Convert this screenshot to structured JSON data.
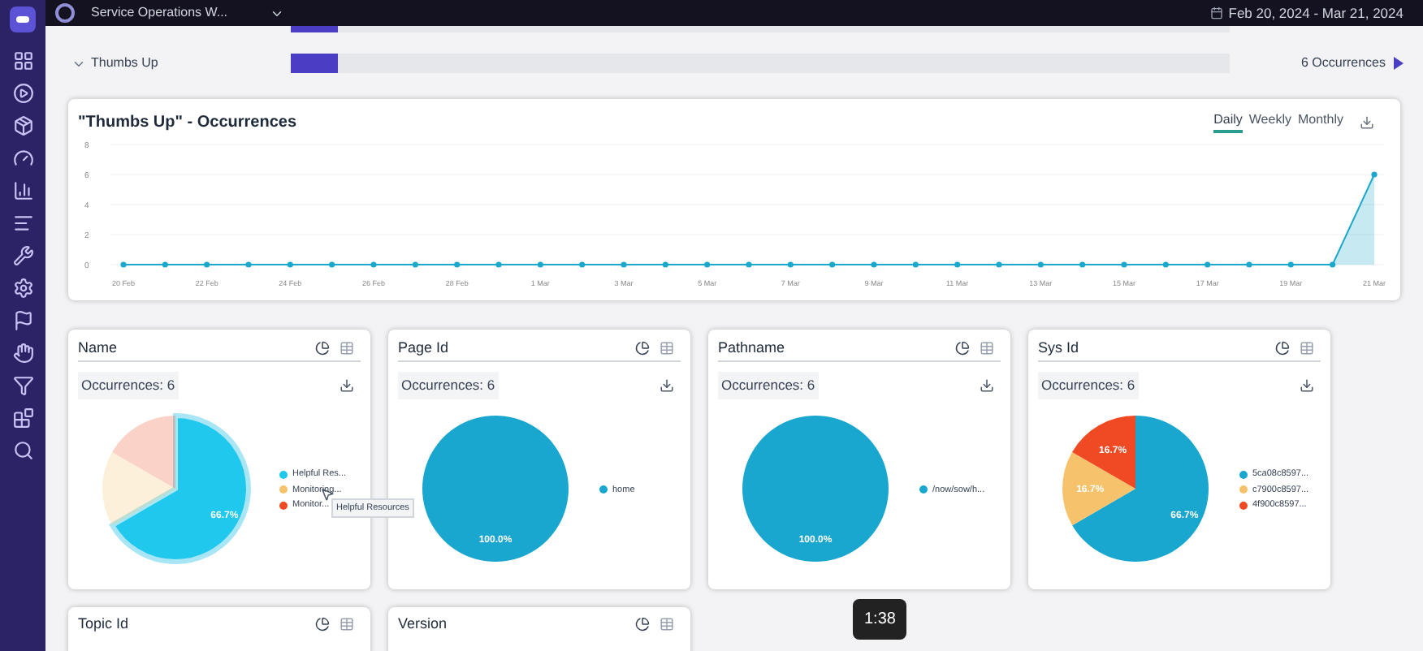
{
  "top_bar": {
    "workspace": "Service Operations W...",
    "date_range": "Feb 20, 2024 - Mar 21, 2024"
  },
  "bars": [
    {
      "level": 0.05
    },
    {
      "label": "Thumbs Up",
      "level": 0.05,
      "expanded": true,
      "count": "6 Occurrences"
    }
  ],
  "trend_card": {
    "title": "\"Thumbs Up\" - Occurrences",
    "tabs": [
      {
        "label": "Daily",
        "selected": true
      },
      {
        "label": "Weekly",
        "selected": false
      },
      {
        "label": "Monthly",
        "selected": false
      }
    ],
    "chart_data": {
      "type": "area",
      "categories": [
        "20 Feb",
        null,
        "22 Feb",
        null,
        "24 Feb",
        null,
        "26 Feb",
        null,
        "28 Feb",
        null,
        "1 Mar",
        null,
        "3 Mar",
        null,
        "5 Mar",
        null,
        "7 Mar",
        null,
        "9 Mar",
        null,
        "11 Mar",
        null,
        "13 Mar",
        null,
        "15 Mar",
        null,
        "17 Mar",
        null,
        "19 Mar",
        null,
        "21 Mar"
      ],
      "series": [
        {
          "color": "#1ba8cc",
          "values": [
            0,
            0,
            0,
            0,
            0,
            0,
            0,
            0,
            0,
            0,
            0,
            0,
            0,
            0,
            0,
            0,
            0,
            0,
            0,
            0,
            0,
            0,
            0,
            0,
            0,
            0,
            0,
            0,
            0,
            0,
            6
          ]
        }
      ],
      "ylim": [
        0,
        8
      ],
      "yticks": [
        0,
        2,
        4,
        6,
        8
      ],
      "grid": true
    }
  },
  "pie_cards": [
    {
      "title": "Name",
      "occurrences": "Occurrences: 6",
      "hovered": [
        true,
        false,
        false
      ],
      "tooltip": "Helpful Resources",
      "chart_data": {
        "type": "pie",
        "categories": [
          "Helpful Res...",
          "Monitoring...",
          "Monitor..."
        ],
        "values": [
          66.7,
          16.7,
          16.7
        ],
        "colors": [
          "#1fc8ec",
          "#f6c26b",
          "#f04a24"
        ],
        "value_labels": [
          "66.7%",
          null,
          null
        ]
      }
    },
    {
      "title": "Page Id",
      "occurrences": "Occurrences: 6",
      "chart_data": {
        "type": "pie",
        "categories": [
          "home"
        ],
        "values": [
          100
        ],
        "colors": [
          "#1aa7cf"
        ],
        "value_labels": [
          "100.0%"
        ]
      }
    },
    {
      "title": "Pathname",
      "occurrences": "Occurrences: 6",
      "chart_data": {
        "type": "pie",
        "categories": [
          "/now/sow/h..."
        ],
        "values": [
          100
        ],
        "colors": [
          "#1aa7cf"
        ],
        "value_labels": [
          "100.0%"
        ]
      }
    },
    {
      "title": "Sys Id",
      "occurrences": "Occurrences: 6",
      "chart_data": {
        "type": "pie",
        "categories": [
          "5ca08c8597...",
          "c7900c8597...",
          "4f900c8597..."
        ],
        "values": [
          66.7,
          16.7,
          16.7
        ],
        "colors": [
          "#1aa7cf",
          "#f6c26b",
          "#f04a24"
        ],
        "value_labels": [
          "66.7%",
          "16.7%",
          "16.7%"
        ]
      }
    }
  ],
  "lower_cards": [
    {
      "title": "Topic Id"
    },
    {
      "title": "Version"
    }
  ],
  "video_time": "1:38"
}
